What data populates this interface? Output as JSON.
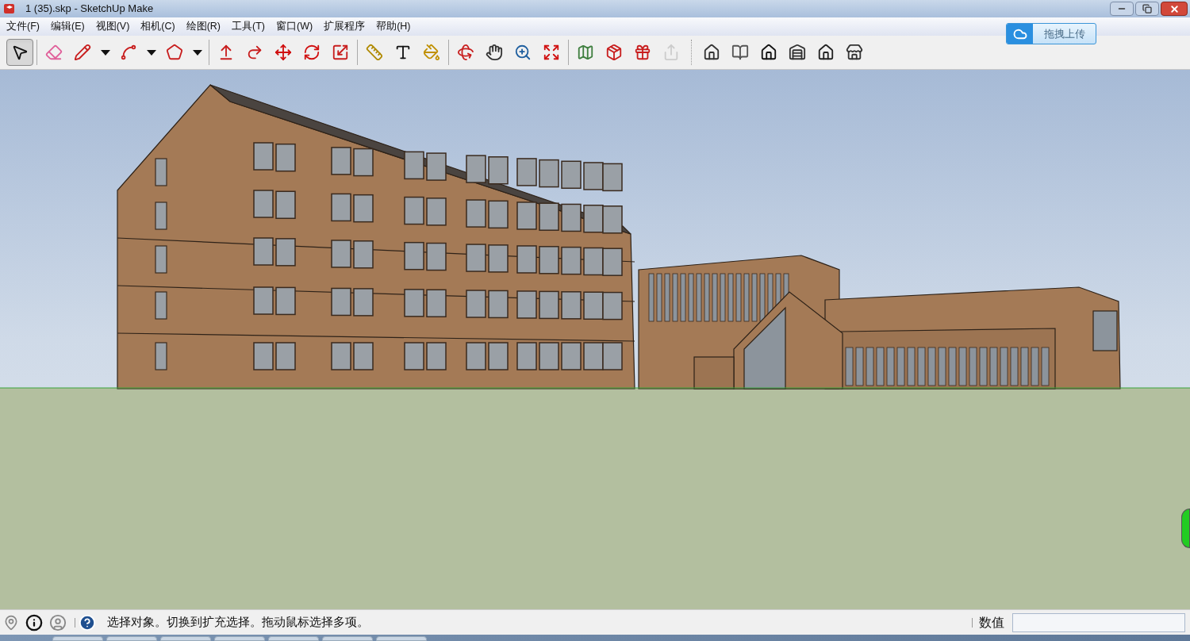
{
  "window": {
    "title": "1 (35).skp - SketchUp Make"
  },
  "menu": [
    {
      "label": "文件(F)"
    },
    {
      "label": "编辑(E)"
    },
    {
      "label": "视图(V)"
    },
    {
      "label": "相机(C)"
    },
    {
      "label": "绘图(R)"
    },
    {
      "label": "工具(T)"
    },
    {
      "label": "窗口(W)"
    },
    {
      "label": "扩展程序"
    },
    {
      "label": "帮助(H)"
    }
  ],
  "upload_button": {
    "label": "拖拽上传"
  },
  "toolbar": {
    "groups": [
      [
        {
          "kind": "tool",
          "selected": true,
          "disabled": false
        }
      ],
      [
        {
          "kind": "tool",
          "selected": false,
          "disabled": false
        },
        {
          "kind": "tool",
          "selected": false,
          "disabled": false
        },
        {
          "kind": "dropdown",
          "selected": false,
          "disabled": false
        },
        {
          "kind": "tool",
          "selected": false,
          "disabled": false
        },
        {
          "kind": "dropdown",
          "selected": false,
          "disabled": false
        },
        {
          "kind": "tool",
          "selected": false,
          "disabled": false
        },
        {
          "kind": "dropdown",
          "selected": false,
          "disabled": false
        }
      ],
      [
        {
          "kind": "tool",
          "selected": false,
          "disabled": false
        },
        {
          "kind": "tool",
          "selected": false,
          "disabled": false
        },
        {
          "kind": "tool",
          "selected": false,
          "disabled": false
        },
        {
          "kind": "tool",
          "selected": false,
          "disabled": false
        },
        {
          "kind": "tool",
          "selected": false,
          "disabled": false
        }
      ],
      [
        {
          "kind": "tool",
          "selected": false,
          "disabled": false
        },
        {
          "kind": "tool",
          "selected": false,
          "disabled": false
        },
        {
          "kind": "tool",
          "selected": false,
          "disabled": false
        }
      ],
      [
        {
          "kind": "tool",
          "selected": false,
          "disabled": false
        },
        {
          "kind": "tool",
          "selected": false,
          "disabled": false
        },
        {
          "kind": "tool",
          "selected": false,
          "disabled": false
        },
        {
          "kind": "tool",
          "selected": false,
          "disabled": false
        }
      ],
      [
        {
          "kind": "tool",
          "selected": false,
          "disabled": false
        },
        {
          "kind": "tool",
          "selected": false,
          "disabled": false
        },
        {
          "kind": "tool",
          "selected": false,
          "disabled": false
        },
        {
          "kind": "tool",
          "selected": false,
          "disabled": true
        }
      ],
      [
        {
          "kind": "tool",
          "selected": false,
          "disabled": false
        },
        {
          "kind": "tool",
          "selected": false,
          "disabled": false
        },
        {
          "kind": "tool",
          "selected": false,
          "disabled": false
        },
        {
          "kind": "tool",
          "selected": false,
          "disabled": false
        },
        {
          "kind": "tool",
          "selected": false,
          "disabled": false
        },
        {
          "kind": "tool",
          "selected": false,
          "disabled": false
        }
      ]
    ]
  },
  "status_bar": {
    "message": "选择对象。切换到扩充选择。拖动鼠标选择多项。",
    "measurement_label": "数值"
  }
}
